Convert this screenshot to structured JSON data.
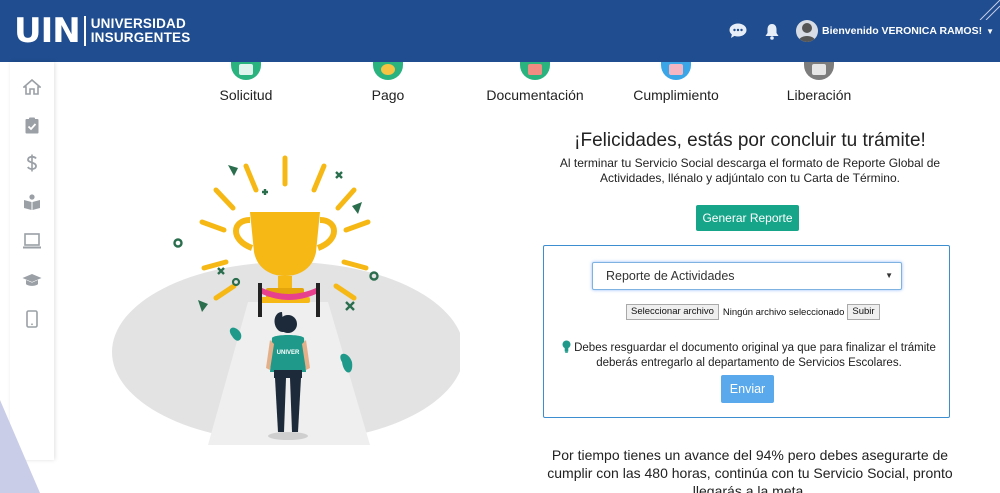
{
  "brand": {
    "short": "UIN",
    "line1": "UNIVERSIDAD",
    "line2": "INSURGENTES"
  },
  "header": {
    "chat_icon": "chat-bubble-icon",
    "bell_icon": "bell-icon",
    "user_greeting": "Bienvenido VERONICA RAMOS!"
  },
  "sidebar": {
    "items": [
      {
        "icon": "home-icon"
      },
      {
        "icon": "clipboard-check-icon"
      },
      {
        "icon": "dollar-icon"
      },
      {
        "icon": "person-book-icon"
      },
      {
        "icon": "laptop-icon"
      },
      {
        "icon": "graduation-cap-icon"
      },
      {
        "icon": "tablet-icon"
      }
    ]
  },
  "steps": [
    {
      "label": "Solicitud",
      "color": "#2ab37f"
    },
    {
      "label": "Pago",
      "color": "#2ab37f"
    },
    {
      "label": "Documentación",
      "color": "#2ab37f"
    },
    {
      "label": "Cumplimiento",
      "color": "#3aa6e8"
    },
    {
      "label": "Liberación",
      "color": "#7d7d7d"
    }
  ],
  "main": {
    "title": "¡Felicidades, estás por concluir tu trámite!",
    "description": "Al terminar tu Servicio Social descarga el formato de Reporte Global de Actividades, llénalo y adjúntalo con tu Carta de Término.",
    "generate_button": "Generar Reporte",
    "upload": {
      "select_value": "Reporte de Actividades",
      "choose_file": "Seleccionar archivo",
      "no_file": "Ningún archivo seleccionado",
      "upload_button": "Subir",
      "note": "Debes resguardar el documento original ya que para finalizar el trámite deberás entregarlo al departamento de Servicios Escolares.",
      "send_button": "Enviar"
    },
    "progress_message": "Por tiempo tienes un avance del 94% pero debes asegurarte de cumplir con las 480 horas, continúa con tu Servicio Social, pronto llegarás a la meta."
  },
  "illustration": {
    "shirt_text": "UNIVER"
  },
  "colors": {
    "navbar": "#1f4d8f",
    "primary_button": "#17a589",
    "send_button": "#5aa9ec",
    "card_border": "#3d8ed0",
    "trophy": "#f6b814"
  }
}
